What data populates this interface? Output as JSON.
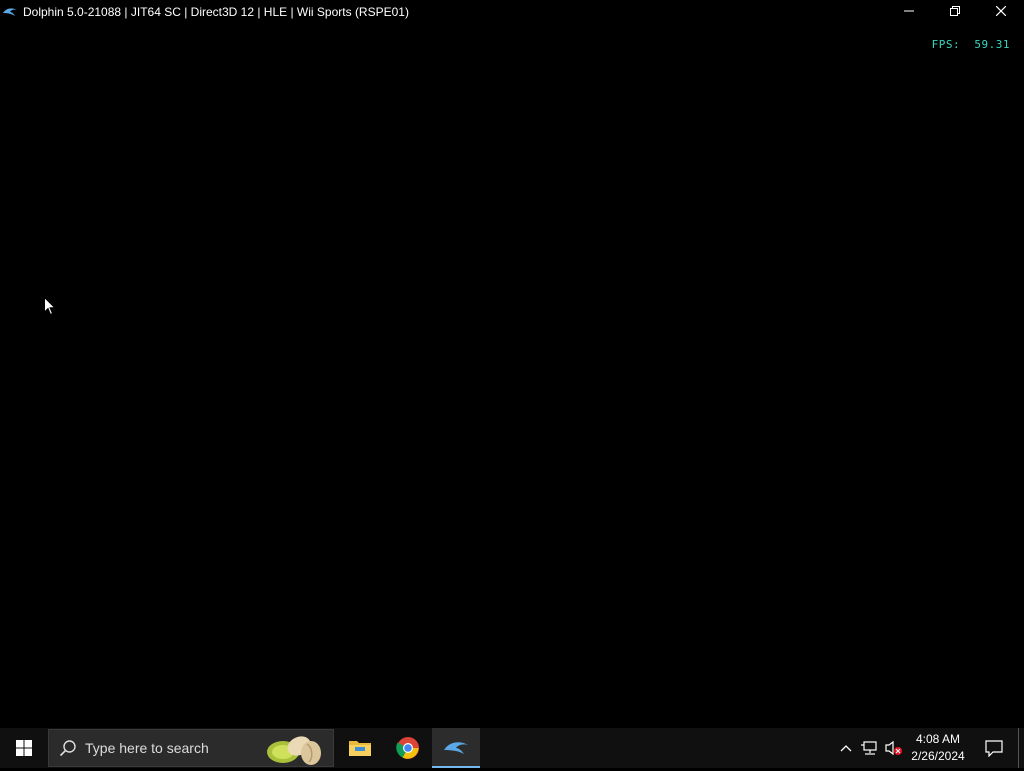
{
  "window": {
    "title": "Dolphin 5.0-21088 | JIT64 SC | Direct3D 12 | HLE | Wii Sports (RSPE01)",
    "app_icon": "dolphin-icon",
    "controls": [
      "minimize-icon",
      "restore-icon",
      "close-icon"
    ]
  },
  "overlay": {
    "fps": "FPS:  59.31"
  },
  "taskbar": {
    "start_icon": "windows-logo-icon",
    "search": {
      "placeholder": "Type here to search",
      "decoration": "pistachio-icon"
    },
    "pinned": [
      {
        "name": "File Explorer",
        "icon": "folder-icon",
        "active": false
      },
      {
        "name": "Google Chrome",
        "icon": "chrome-icon",
        "active": false
      },
      {
        "name": "Dolphin",
        "icon": "dolphin-icon",
        "active": true
      }
    ],
    "tray": {
      "icons": [
        "chevron-up-icon",
        "network-icon",
        "volume-muted-icon"
      ],
      "time": "4:08 AM",
      "date": "2/26/2024",
      "notification_icon": "notification-icon"
    }
  },
  "colors": {
    "fps_text": "#36d6c0",
    "taskbar_bg": "#101010",
    "active_indicator": "#76b9ed"
  }
}
